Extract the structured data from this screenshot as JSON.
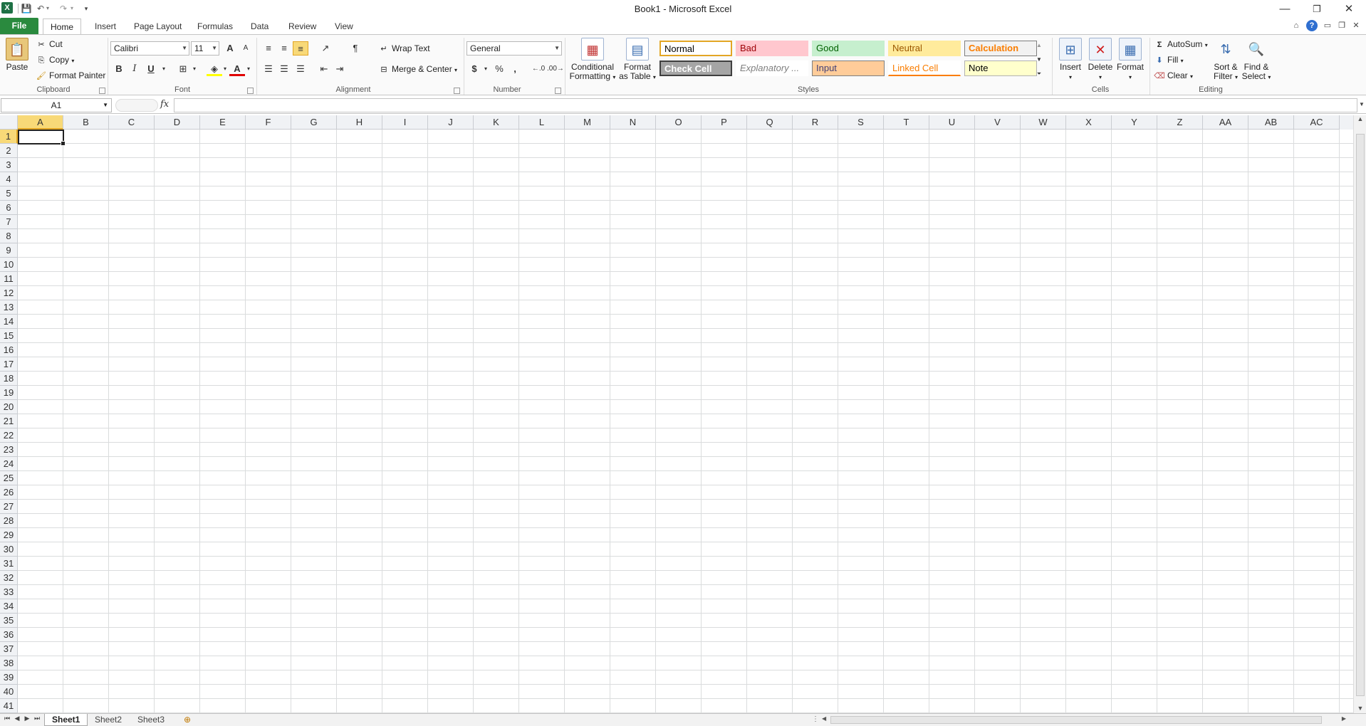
{
  "window": {
    "title": "Book1 - Microsoft Excel",
    "minimize": "—",
    "restore": "❐",
    "close": "✕"
  },
  "qat": {
    "app_glyph": "X",
    "save": "💾",
    "undo": "↶",
    "redo": "↷",
    "customize": "▾"
  },
  "tabs": [
    "File",
    "Home",
    "Insert",
    "Page Layout",
    "Formulas",
    "Data",
    "Review",
    "View"
  ],
  "ribbon": {
    "clipboard": {
      "paste": "Paste",
      "cut": "Cut",
      "copy": "Copy",
      "format_painter": "Format Painter",
      "label": "Clipboard"
    },
    "font": {
      "name": "Calibri",
      "size": "11",
      "bold": "B",
      "italic": "I",
      "underline": "U",
      "grow": "A",
      "shrink": "A",
      "font_color": "A",
      "label": "Font"
    },
    "alignment": {
      "wrap_text": "Wrap Text",
      "merge_center": "Merge & Center",
      "label": "Alignment"
    },
    "number": {
      "format": "General",
      "currency": "$",
      "percent": "%",
      "comma": ",",
      "label": "Number"
    },
    "styles": {
      "conditional_formatting": [
        "Conditional",
        "Formatting"
      ],
      "format_as_table": [
        "Format",
        "as Table"
      ],
      "cells": [
        {
          "label": "Normal",
          "bg": "#ffffff",
          "fg": "#000000",
          "border": "#e3a625"
        },
        {
          "label": "Bad",
          "bg": "#ffc7ce",
          "fg": "#9c0006",
          "border": "#ffc7ce"
        },
        {
          "label": "Good",
          "bg": "#c6efce",
          "fg": "#006100",
          "border": "#c6efce"
        },
        {
          "label": "Neutral",
          "bg": "#ffeb9c",
          "fg": "#9c5700",
          "border": "#ffeb9c"
        },
        {
          "label": "Calculation",
          "bg": "#f2f2f2",
          "fg": "#fa7d00",
          "border": "#7f7f7f"
        },
        {
          "label": "Check Cell",
          "bg": "#a5a5a5",
          "fg": "#ffffff",
          "border": "#3f3f3f"
        },
        {
          "label": "Explanatory ...",
          "bg": "#ffffff",
          "fg": "#7f7f7f",
          "border": "#ffffff"
        },
        {
          "label": "Input",
          "bg": "#ffcc99",
          "fg": "#3f3f76",
          "border": "#7f7f7f"
        },
        {
          "label": "Linked Cell",
          "bg": "#ffffff",
          "fg": "#fa7d00",
          "border": "#ffffff"
        },
        {
          "label": "Note",
          "bg": "#ffffcc",
          "fg": "#000000",
          "border": "#b2b2b2"
        }
      ],
      "label": "Styles"
    },
    "cells_group": {
      "insert": "Insert",
      "delete": "Delete",
      "format": "Format",
      "label": "Cells"
    },
    "editing": {
      "autosum": "AutoSum",
      "fill": "Fill",
      "clear": "Clear",
      "sort_filter": [
        "Sort &",
        "Filter"
      ],
      "find_select": [
        "Find &",
        "Select"
      ],
      "label": "Editing"
    }
  },
  "formula_bar": {
    "name_box": "A1",
    "fx": "fx",
    "content": ""
  },
  "grid": {
    "columns": [
      "A",
      "B",
      "C",
      "D",
      "E",
      "F",
      "G",
      "H",
      "I",
      "J",
      "K",
      "L",
      "M",
      "N",
      "O",
      "P",
      "Q",
      "R",
      "S",
      "T",
      "U",
      "V",
      "W",
      "X",
      "Y",
      "Z",
      "AA",
      "AB",
      "AC"
    ],
    "rows_visible": 41,
    "active_cell": "A1"
  },
  "sheets": [
    "Sheet1",
    "Sheet2",
    "Sheet3"
  ],
  "active_sheet": "Sheet1"
}
